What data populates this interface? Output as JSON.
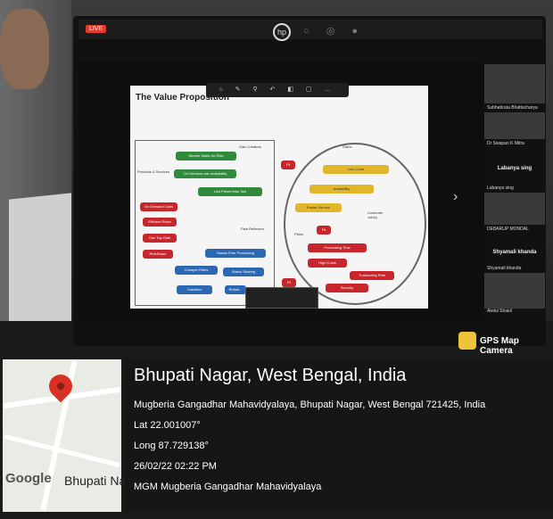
{
  "overlay": {
    "app_label": "GPS Map Camera",
    "title": "Bhupati Nagar, West Bengal, India",
    "address": "Mugberia Gangadhar Mahavidyalaya, Bhupati Nagar, West Bengal 721425, India",
    "lat": "Lat 22.001007°",
    "long": "Long 87.729138°",
    "datetime": "26/02/22 02:22 PM",
    "note": "MGM Mugberia Gangadhar Mahavidyalaya",
    "map_brand": "Google",
    "map_place": "Bhupati Nagar"
  },
  "meeting": {
    "live_badge": "LIVE",
    "hp_logo": "hp",
    "slide": {
      "title": "The Value Proposition",
      "left_boxes": [
        "Shorter Waits for Ride",
        "On Demand cab availability",
        "Low Prices than Taxi",
        "Hassle Free Processing",
        "Cheaper Rides",
        "Status Sharing",
        "Cashless",
        "Reliab..."
      ],
      "products": [
        "On Demand Cabs",
        "Efficient Rides",
        "One Tap Ride",
        "RideShare"
      ],
      "gains": [
        "Low Costs",
        "Availability",
        "Easier Service"
      ],
      "pains": [
        "Processing Time",
        "High Costs",
        "Trustworthy Ride",
        "Security"
      ],
      "labels": {
        "gain_creators": "Gain Creators",
        "pain_relievers": "Pain Relievers",
        "products": "Products & Services",
        "gains": "Gains",
        "pains": "Pains",
        "customer_job": "Customer Job(s)",
        "fit": "Fit"
      }
    },
    "participants": [
      "Subhabrata Bhattacharya",
      "Dr Swapan K Mitra",
      "Labanya sing",
      "DEBARUP MONDAL",
      "Shyamali khanda",
      "Abdul Shakil"
    ]
  }
}
